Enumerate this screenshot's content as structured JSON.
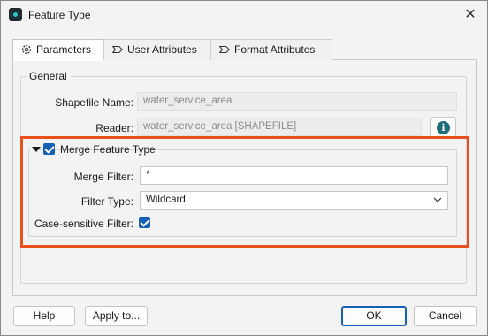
{
  "window": {
    "title": "Feature Type"
  },
  "tabs": [
    {
      "label": "Parameters",
      "icon": "gear-icon"
    },
    {
      "label": "User Attributes",
      "icon": "tag-icon"
    },
    {
      "label": "Format Attributes",
      "icon": "tag-icon"
    }
  ],
  "general": {
    "title": "General",
    "shapefile_name_label": "Shapefile Name:",
    "shapefile_name_value": "water_service_area",
    "reader_label": "Reader:",
    "reader_value": "water_service_area [SHAPEFILE]",
    "info_glyph": "i"
  },
  "merge": {
    "title": "Merge Feature Type",
    "enabled": true,
    "merge_filter_label": "Merge Filter:",
    "merge_filter_value": "*",
    "filter_type_label": "Filter Type:",
    "filter_type_value": "Wildcard",
    "case_sensitive_label": "Case-sensitive Filter:",
    "case_sensitive": true
  },
  "buttons": {
    "help": "Help",
    "apply": "Apply to...",
    "ok": "OK",
    "cancel": "Cancel"
  },
  "colors": {
    "accent": "#1461b8",
    "highlight": "#e8501c"
  }
}
